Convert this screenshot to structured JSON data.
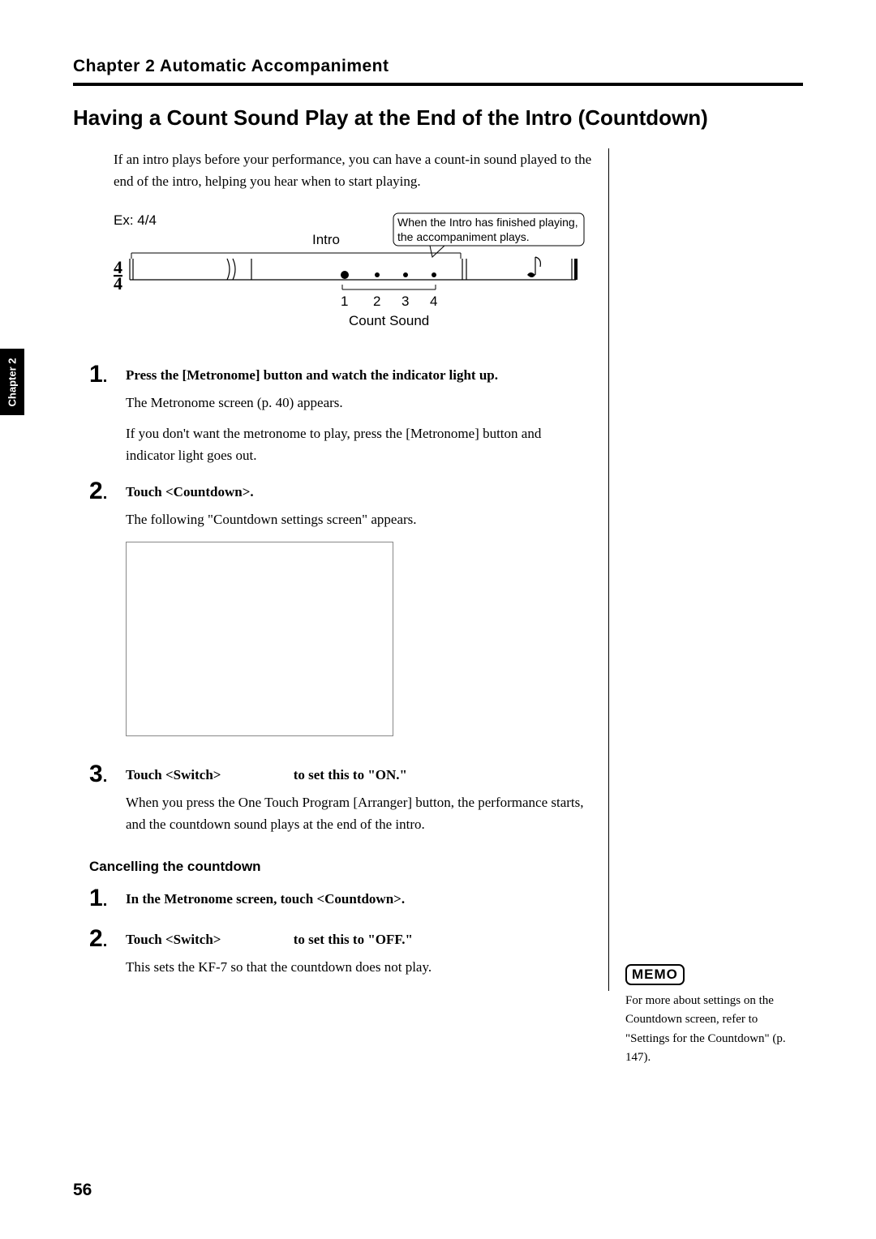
{
  "chapter_header": "Chapter 2  Automatic Accompaniment",
  "main_heading": "Having a Count Sound Play at the End of the Intro (Countdown)",
  "intro_text": "If an intro plays before your performance, you can have a count-in sound played to the end of the intro, helping you hear when to start playing.",
  "diagram": {
    "ex_label": "Ex: 4/4",
    "intro_label": "Intro",
    "callout_line1": "When the Intro has finished playing,",
    "callout_line2": "the accompaniment plays.",
    "count_sound_label": "Count Sound",
    "numbers": [
      "1",
      "2",
      "3",
      "4"
    ]
  },
  "steps_main": {
    "1": {
      "title": "Press the [Metronome] button and watch the indicator light up.",
      "text1": "The Metronome screen (p. 40) appears.",
      "text2": "If you don't want the metronome to play, press the [Metronome] button and indicator light goes out."
    },
    "2": {
      "title": "Touch <Countdown>.",
      "text1": "The following \"Countdown settings screen\" appears."
    },
    "3": {
      "title": "Touch <Switch>                     to set this to \"ON.\"",
      "text1": "When you press the One Touch Program [Arranger] button, the performance starts, and the countdown sound plays at the end of the intro."
    }
  },
  "cancel": {
    "heading": "Cancelling the countdown",
    "1": {
      "title": "In the Metronome screen, touch <Countdown>."
    },
    "2": {
      "title": "Touch <Switch>                     to set this to \"OFF.\"",
      "text1": "This sets the KF-7 so that the countdown does not play."
    }
  },
  "side_tab": "Chapter 2",
  "memo": {
    "label": "MEMO",
    "text": "For more about settings on the Countdown screen, refer to \"Settings for the Countdown\" (p. 147)."
  },
  "page_number": "56"
}
